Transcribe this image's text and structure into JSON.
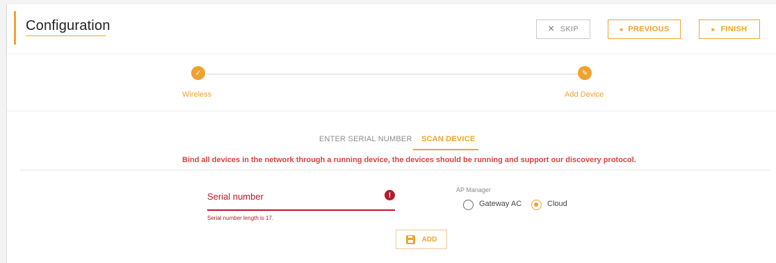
{
  "header": {
    "title": "Configuration",
    "skip_icon": "×",
    "skip_label": "SKIP",
    "previous_icon": "◂",
    "previous_label": "PREVIOUS",
    "finish_icon": "▸",
    "finish_label": "FINISH"
  },
  "stepper": {
    "steps": [
      {
        "label": "Wireless",
        "icon": "check-icon",
        "glyph": "✓"
      },
      {
        "label": "Add Device",
        "icon": "pencil-icon",
        "glyph": "✎"
      }
    ]
  },
  "tabs": {
    "items": [
      {
        "label": "ENTER SERIAL NUMBER",
        "active": false
      },
      {
        "label": "SCAN DEVICE",
        "active": true
      }
    ],
    "notice": "Bind all devices in the network through a running device, the devices should be running and support our discovery protocol."
  },
  "form": {
    "serial_label": "Serial number",
    "serial_value": "",
    "error_glyph": "!",
    "error_text": "Serial number length is 17.",
    "ap_manager_label": "AP Manager",
    "options": [
      {
        "label": "Gateway AC",
        "selected": false
      },
      {
        "label": "Cloud",
        "selected": true
      }
    ],
    "add_label": "ADD"
  },
  "colors": {
    "accent": "#f0a22e",
    "error": "#b5192a",
    "notice": "#d84444"
  }
}
